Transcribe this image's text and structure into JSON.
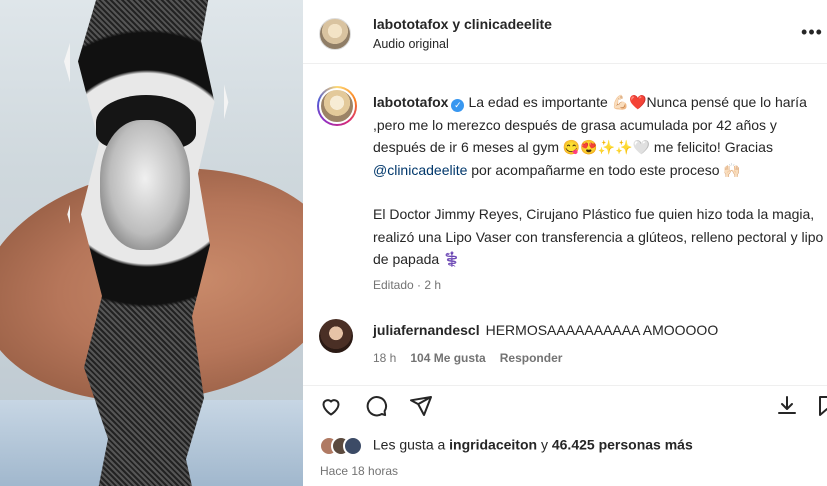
{
  "header": {
    "title": "labototafox y clinicadeelite",
    "subtitle": "Audio original",
    "more_icon": "more-horizontal-icon"
  },
  "caption": {
    "username": "labototafox",
    "line1": "La edad es importante 💪🏻❤️Nunca pensé que lo haría ,pero me lo merezco después de grasa acumulada por 42 años y después de ir 6 meses al gym 😋😍✨✨🤍 me felicito! Gracias ",
    "mention": "@clinicadeelite",
    "line1_end": " por acompañarme en todo este proceso 🙌🏻",
    "paragraph2": "El Doctor Jimmy Reyes, Cirujano Plástico fue quien hizo toda la magia, realizó una Lipo Vaser con transferencia a glúteos, relleno pectoral y lipo de papada ⚕️",
    "meta": "Editado · 2 h"
  },
  "comment": {
    "username": "juliafernandescl",
    "text": "HERMOSAAAAAAAAAA AMOOOOO",
    "time": "18 h",
    "likes": "104 Me gusta",
    "reply": "Responder"
  },
  "actions": {
    "likes_prefix": "Les gusta a ",
    "likes_user": "ingridaceiton",
    "likes_mid": " y ",
    "likes_count": "46.425 personas más",
    "time_ago": "Hace 18 horas"
  },
  "colors": {
    "link": "#00376b",
    "secondary": "#737373",
    "verified": "#3897f0"
  }
}
